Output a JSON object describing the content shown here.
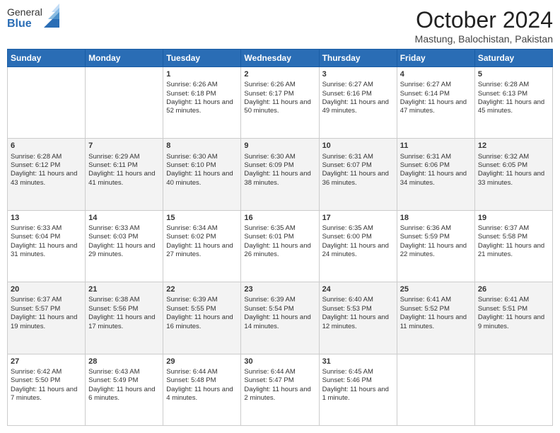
{
  "header": {
    "logo_general": "General",
    "logo_blue": "Blue",
    "title": "October 2024",
    "subtitle": "Mastung, Balochistan, Pakistan"
  },
  "weekdays": [
    "Sunday",
    "Monday",
    "Tuesday",
    "Wednesday",
    "Thursday",
    "Friday",
    "Saturday"
  ],
  "weeks": [
    [
      {
        "day": "",
        "sunrise": "",
        "sunset": "",
        "daylight": ""
      },
      {
        "day": "",
        "sunrise": "",
        "sunset": "",
        "daylight": ""
      },
      {
        "day": "1",
        "sunrise": "Sunrise: 6:26 AM",
        "sunset": "Sunset: 6:18 PM",
        "daylight": "Daylight: 11 hours and 52 minutes."
      },
      {
        "day": "2",
        "sunrise": "Sunrise: 6:26 AM",
        "sunset": "Sunset: 6:17 PM",
        "daylight": "Daylight: 11 hours and 50 minutes."
      },
      {
        "day": "3",
        "sunrise": "Sunrise: 6:27 AM",
        "sunset": "Sunset: 6:16 PM",
        "daylight": "Daylight: 11 hours and 49 minutes."
      },
      {
        "day": "4",
        "sunrise": "Sunrise: 6:27 AM",
        "sunset": "Sunset: 6:14 PM",
        "daylight": "Daylight: 11 hours and 47 minutes."
      },
      {
        "day": "5",
        "sunrise": "Sunrise: 6:28 AM",
        "sunset": "Sunset: 6:13 PM",
        "daylight": "Daylight: 11 hours and 45 minutes."
      }
    ],
    [
      {
        "day": "6",
        "sunrise": "Sunrise: 6:28 AM",
        "sunset": "Sunset: 6:12 PM",
        "daylight": "Daylight: 11 hours and 43 minutes."
      },
      {
        "day": "7",
        "sunrise": "Sunrise: 6:29 AM",
        "sunset": "Sunset: 6:11 PM",
        "daylight": "Daylight: 11 hours and 41 minutes."
      },
      {
        "day": "8",
        "sunrise": "Sunrise: 6:30 AM",
        "sunset": "Sunset: 6:10 PM",
        "daylight": "Daylight: 11 hours and 40 minutes."
      },
      {
        "day": "9",
        "sunrise": "Sunrise: 6:30 AM",
        "sunset": "Sunset: 6:09 PM",
        "daylight": "Daylight: 11 hours and 38 minutes."
      },
      {
        "day": "10",
        "sunrise": "Sunrise: 6:31 AM",
        "sunset": "Sunset: 6:07 PM",
        "daylight": "Daylight: 11 hours and 36 minutes."
      },
      {
        "day": "11",
        "sunrise": "Sunrise: 6:31 AM",
        "sunset": "Sunset: 6:06 PM",
        "daylight": "Daylight: 11 hours and 34 minutes."
      },
      {
        "day": "12",
        "sunrise": "Sunrise: 6:32 AM",
        "sunset": "Sunset: 6:05 PM",
        "daylight": "Daylight: 11 hours and 33 minutes."
      }
    ],
    [
      {
        "day": "13",
        "sunrise": "Sunrise: 6:33 AM",
        "sunset": "Sunset: 6:04 PM",
        "daylight": "Daylight: 11 hours and 31 minutes."
      },
      {
        "day": "14",
        "sunrise": "Sunrise: 6:33 AM",
        "sunset": "Sunset: 6:03 PM",
        "daylight": "Daylight: 11 hours and 29 minutes."
      },
      {
        "day": "15",
        "sunrise": "Sunrise: 6:34 AM",
        "sunset": "Sunset: 6:02 PM",
        "daylight": "Daylight: 11 hours and 27 minutes."
      },
      {
        "day": "16",
        "sunrise": "Sunrise: 6:35 AM",
        "sunset": "Sunset: 6:01 PM",
        "daylight": "Daylight: 11 hours and 26 minutes."
      },
      {
        "day": "17",
        "sunrise": "Sunrise: 6:35 AM",
        "sunset": "Sunset: 6:00 PM",
        "daylight": "Daylight: 11 hours and 24 minutes."
      },
      {
        "day": "18",
        "sunrise": "Sunrise: 6:36 AM",
        "sunset": "Sunset: 5:59 PM",
        "daylight": "Daylight: 11 hours and 22 minutes."
      },
      {
        "day": "19",
        "sunrise": "Sunrise: 6:37 AM",
        "sunset": "Sunset: 5:58 PM",
        "daylight": "Daylight: 11 hours and 21 minutes."
      }
    ],
    [
      {
        "day": "20",
        "sunrise": "Sunrise: 6:37 AM",
        "sunset": "Sunset: 5:57 PM",
        "daylight": "Daylight: 11 hours and 19 minutes."
      },
      {
        "day": "21",
        "sunrise": "Sunrise: 6:38 AM",
        "sunset": "Sunset: 5:56 PM",
        "daylight": "Daylight: 11 hours and 17 minutes."
      },
      {
        "day": "22",
        "sunrise": "Sunrise: 6:39 AM",
        "sunset": "Sunset: 5:55 PM",
        "daylight": "Daylight: 11 hours and 16 minutes."
      },
      {
        "day": "23",
        "sunrise": "Sunrise: 6:39 AM",
        "sunset": "Sunset: 5:54 PM",
        "daylight": "Daylight: 11 hours and 14 minutes."
      },
      {
        "day": "24",
        "sunrise": "Sunrise: 6:40 AM",
        "sunset": "Sunset: 5:53 PM",
        "daylight": "Daylight: 11 hours and 12 minutes."
      },
      {
        "day": "25",
        "sunrise": "Sunrise: 6:41 AM",
        "sunset": "Sunset: 5:52 PM",
        "daylight": "Daylight: 11 hours and 11 minutes."
      },
      {
        "day": "26",
        "sunrise": "Sunrise: 6:41 AM",
        "sunset": "Sunset: 5:51 PM",
        "daylight": "Daylight: 11 hours and 9 minutes."
      }
    ],
    [
      {
        "day": "27",
        "sunrise": "Sunrise: 6:42 AM",
        "sunset": "Sunset: 5:50 PM",
        "daylight": "Daylight: 11 hours and 7 minutes."
      },
      {
        "day": "28",
        "sunrise": "Sunrise: 6:43 AM",
        "sunset": "Sunset: 5:49 PM",
        "daylight": "Daylight: 11 hours and 6 minutes."
      },
      {
        "day": "29",
        "sunrise": "Sunrise: 6:44 AM",
        "sunset": "Sunset: 5:48 PM",
        "daylight": "Daylight: 11 hours and 4 minutes."
      },
      {
        "day": "30",
        "sunrise": "Sunrise: 6:44 AM",
        "sunset": "Sunset: 5:47 PM",
        "daylight": "Daylight: 11 hours and 2 minutes."
      },
      {
        "day": "31",
        "sunrise": "Sunrise: 6:45 AM",
        "sunset": "Sunset: 5:46 PM",
        "daylight": "Daylight: 11 hours and 1 minute."
      },
      {
        "day": "",
        "sunrise": "",
        "sunset": "",
        "daylight": ""
      },
      {
        "day": "",
        "sunrise": "",
        "sunset": "",
        "daylight": ""
      }
    ]
  ]
}
